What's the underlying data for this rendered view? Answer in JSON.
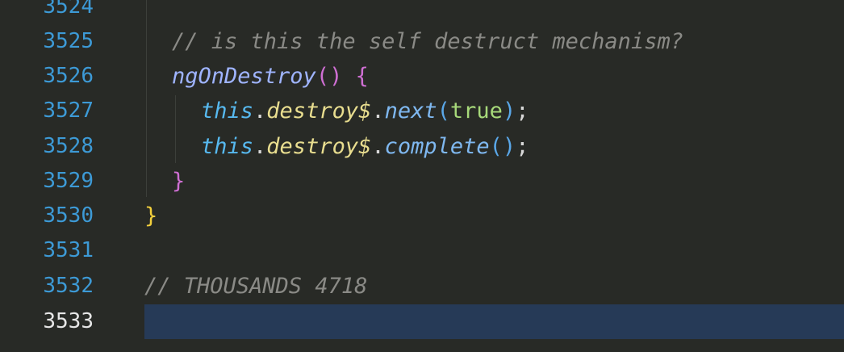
{
  "editor": {
    "lines": [
      {
        "number": "3524"
      },
      {
        "number": "3525",
        "comment": "// is this the self destruct mechanism?"
      },
      {
        "number": "3526",
        "func": "ngOnDestroy",
        "parens": "()",
        "brace": "{"
      },
      {
        "number": "3527",
        "this": "this",
        "dot1": ".",
        "prop": "destroy$",
        "dot2": ".",
        "method": "next",
        "open": "(",
        "arg": "true",
        "close": ")",
        "semi": ";"
      },
      {
        "number": "3528",
        "this": "this",
        "dot1": ".",
        "prop": "destroy$",
        "dot2": ".",
        "method": "complete",
        "open": "(",
        "close": ")",
        "semi": ";"
      },
      {
        "number": "3529",
        "brace": "}"
      },
      {
        "number": "3530",
        "brace": "}"
      },
      {
        "number": "3531"
      },
      {
        "number": "3532",
        "comment": "// THOUSANDS 4718"
      },
      {
        "number": "3533"
      }
    ]
  },
  "colors": {
    "background": "#282a26",
    "line_number": "#3d9ad6",
    "line_number_active": "#e6e6e6",
    "current_line": "#263a57"
  }
}
